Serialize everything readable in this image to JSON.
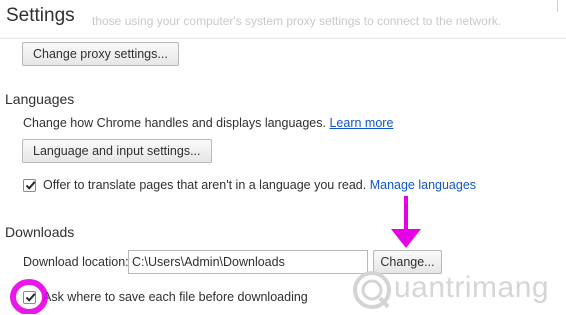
{
  "header": {
    "title": "Settings",
    "background_text": "those using your computer's system proxy settings to connect to the network."
  },
  "network": {
    "proxy_button": "Change proxy settings..."
  },
  "languages": {
    "title": "Languages",
    "description": "Change how Chrome handles and displays languages.",
    "learn_more": "Learn more",
    "settings_button": "Language and input settings...",
    "translate_label": "Offer to translate pages that aren't in a language you read.",
    "translate_checked": true,
    "manage_link": "Manage languages"
  },
  "downloads": {
    "title": "Downloads",
    "location_label": "Download location:",
    "location_value": "C:\\Users\\Admin\\Downloads",
    "change_button": "Change...",
    "ask_label": "Ask where to save each file before downloading",
    "ask_checked": true
  },
  "annotations": {
    "arrow_color": "#e600e6",
    "highlight_color": "#e600e6"
  },
  "watermark": {
    "text": "uantrimang",
    "icon": "quantrimang-logo-icon"
  }
}
